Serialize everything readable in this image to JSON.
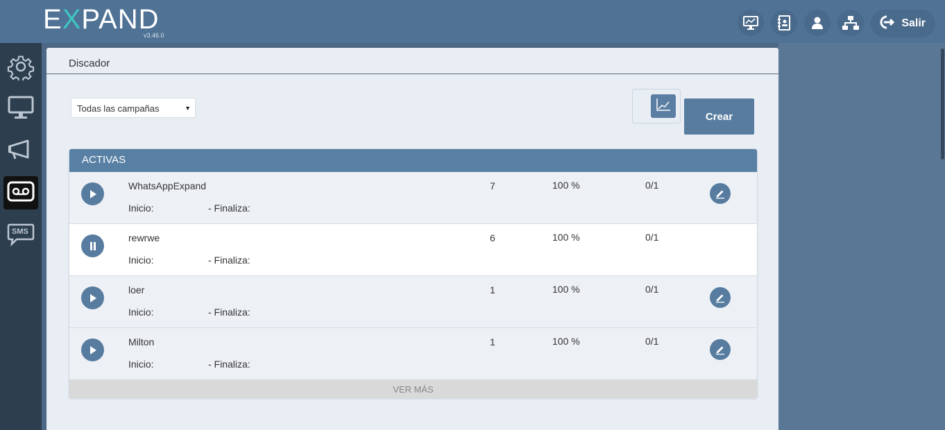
{
  "header": {
    "logo_prefix": "E",
    "logo_x": "X",
    "logo_rest": "PAND",
    "version": "v3.46.0",
    "icons": [
      "monitor-chart-icon",
      "contacts-icon",
      "user-icon",
      "network-icon"
    ],
    "logout_label": "Salir"
  },
  "sidebar": {
    "items": [
      {
        "icon": "gear-icon",
        "active": false
      },
      {
        "icon": "monitor-icon",
        "active": false
      },
      {
        "icon": "megaphone-icon",
        "active": false
      },
      {
        "icon": "voicemail-icon",
        "active": true
      },
      {
        "icon": "sms-icon",
        "active": false
      }
    ],
    "sms_label": "SMS"
  },
  "page": {
    "title": "Discador",
    "filter_value": "Todas las campañas",
    "create_label": "Crear"
  },
  "campaigns": {
    "section_title": "ACTIVAS",
    "inicio_label": "Inicio:",
    "finaliza_label": "- Finaliza:",
    "rows": [
      {
        "name": "WhatsAppExpand",
        "count": "7",
        "percent": "100 %",
        "ratio": "0/1",
        "state": "paused",
        "editable": true
      },
      {
        "name": "rewrwe",
        "count": "6",
        "percent": "100 %",
        "ratio": "0/1",
        "state": "running",
        "editable": false
      },
      {
        "name": "loer",
        "count": "1",
        "percent": "100 %",
        "ratio": "0/1",
        "state": "paused",
        "editable": true
      },
      {
        "name": "Milton",
        "count": "1",
        "percent": "100 %",
        "ratio": "0/1",
        "state": "paused",
        "editable": true
      }
    ],
    "more_label": "VER MÁS"
  },
  "colors": {
    "header": "#4f7295",
    "sidebar": "#2d3e4f",
    "accent": "#587c9f",
    "logo_x": "#3fc6c0"
  }
}
